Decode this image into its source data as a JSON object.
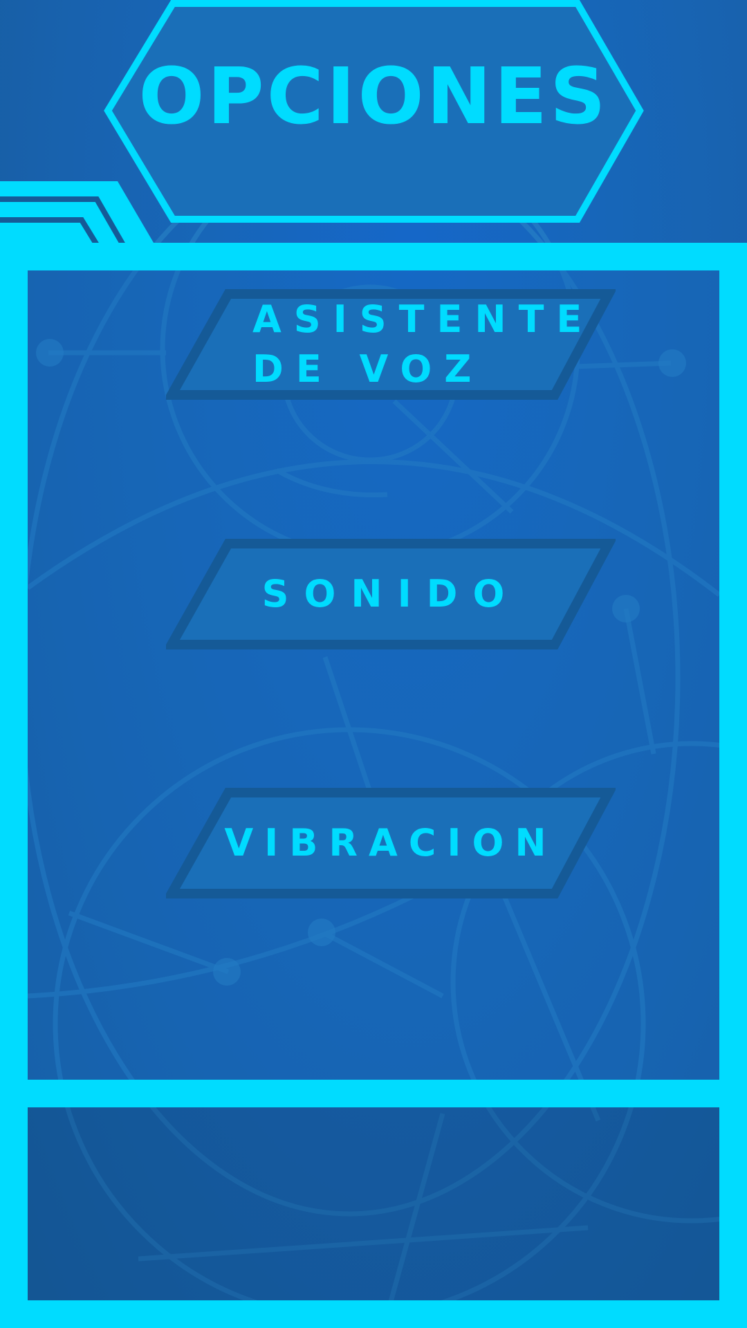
{
  "title": "OPCIONES",
  "menu": {
    "voice_assistant": {
      "line1": "ASISTENTE",
      "line2": "DE VOZ"
    },
    "sound": "SONIDO",
    "vibration": "VIBRACION"
  },
  "colors": {
    "accent": "#00dcff",
    "background": "#1766b8",
    "button_border": "#155a97"
  }
}
